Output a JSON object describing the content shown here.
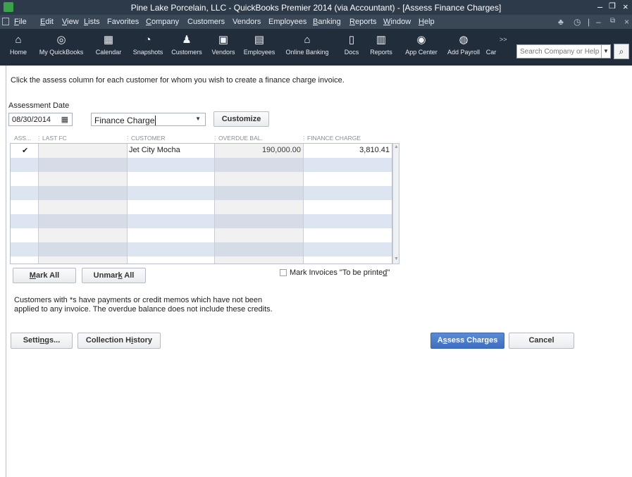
{
  "window": {
    "title": "Pine Lake Porcelain, LLC  - QuickBooks Premier 2014 (via Accountant)  - [Assess Finance Charges]"
  },
  "menu": {
    "items": [
      {
        "label": "File",
        "ul": "F",
        "rest": "ile"
      },
      {
        "label": "Edit",
        "ul": "E",
        "rest": "dit"
      },
      {
        "label": "View",
        "ul": "V",
        "rest": "iew"
      },
      {
        "label": "Lists",
        "ul": "L",
        "rest": "ists"
      },
      {
        "label": "Favorites",
        "ul": "",
        "rest": "Favorites"
      },
      {
        "label": "Company",
        "ul": "C",
        "rest": "ompany"
      },
      {
        "label": "Customers",
        "ul": "",
        "rest": "Customers"
      },
      {
        "label": "Vendors",
        "ul": "",
        "rest": "Vendors"
      },
      {
        "label": "Employees",
        "ul": "",
        "rest": "Employees"
      },
      {
        "label": "Banking",
        "ul": "B",
        "rest": "anking"
      },
      {
        "label": "Reports",
        "ul": "R",
        "rest": "eports"
      },
      {
        "label": "Window",
        "ul": "W",
        "rest": "indow"
      },
      {
        "label": "Help",
        "ul": "H",
        "rest": "elp"
      }
    ]
  },
  "toolbar": {
    "items": [
      {
        "label": "Home",
        "icon": "home-icon",
        "glyph": "⌂"
      },
      {
        "label": "My QuickBooks",
        "icon": "my-quickbooks-icon",
        "glyph": "◎"
      },
      {
        "label": "Calendar",
        "icon": "calendar-icon",
        "glyph": "▦"
      },
      {
        "label": "Snapshots",
        "icon": "snapshots-icon",
        "glyph": "◔"
      },
      {
        "label": "Customers",
        "icon": "customers-icon",
        "glyph": "♟"
      },
      {
        "label": "Vendors",
        "icon": "vendors-icon",
        "glyph": "▣"
      },
      {
        "label": "Employees",
        "icon": "employees-icon",
        "glyph": "▤"
      },
      {
        "label": "Online Banking",
        "icon": "bank-icon",
        "glyph": "⌂"
      },
      {
        "label": "Docs",
        "icon": "docs-icon",
        "glyph": "▯"
      },
      {
        "label": "Reports",
        "icon": "reports-icon",
        "glyph": "▥"
      },
      {
        "label": "App Center",
        "icon": "app-center-icon",
        "glyph": "◉"
      },
      {
        "label": "Add Payroll",
        "icon": "add-payroll-icon",
        "glyph": "◍"
      },
      {
        "label": "Car",
        "icon": "car-icon",
        "glyph": ""
      }
    ],
    "more": ">>",
    "search_placeholder": "Search Company or Help"
  },
  "form": {
    "instruction": "Click the assess column for each customer for whom you wish to create a finance charge invoice.",
    "assessment_date_label": "Assessment Date",
    "assessment_date": "08/30/2014",
    "template": "Finance Charge",
    "customize_label": "Customize",
    "columns": [
      "ASS...",
      "LAST FC",
      "CUSTOMER",
      "OVERDUE BAL.",
      "FINANCE CHARGE"
    ],
    "rows": [
      {
        "assess": "✔",
        "last_fc": "",
        "customer": "Jet City Mocha",
        "overdue_bal": "190,000.00",
        "finance_charge": "3,810.41"
      }
    ],
    "mark_all": {
      "pre": "",
      "ul": "M",
      "post": "ark All"
    },
    "unmark_all": {
      "pre": "Unmar",
      "ul": "k",
      "post": " All"
    },
    "print_label": {
      "pre": "Mark Invoices \"To be printe",
      "ul": "d",
      "post": "\""
    },
    "note_line1": "Customers with *s have payments or credit memos which have not been",
    "note_line2": "applied to any invoice.  The overdue balance does not include these credits.",
    "settings": {
      "pre": "Setti",
      "ul": "n",
      "post": "gs..."
    },
    "collection_history": {
      "pre": "Collection H",
      "ul": "i",
      "post": "story"
    },
    "assess_charges": {
      "pre": "A",
      "ul": "s",
      "post": "sess Charges"
    },
    "cancel_label": "Cancel"
  },
  "colors": {
    "titlebar": "#2d3a4a",
    "iconbar": "#222d3b",
    "row_alt": "#dde5f3",
    "primary_button": "#3e6fc0"
  }
}
